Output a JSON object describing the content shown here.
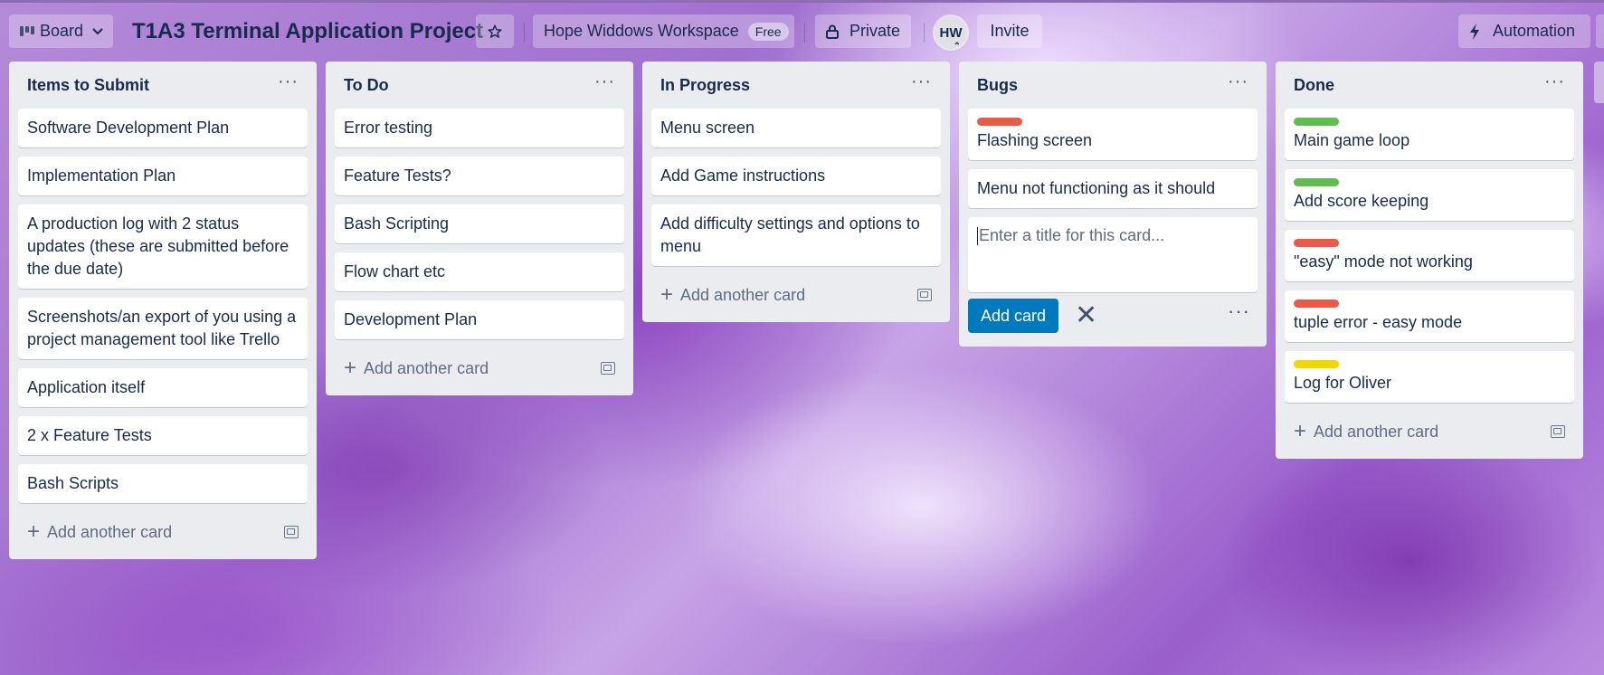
{
  "header": {
    "view_label": "Board",
    "board_title": "T1A3 Terminal Application Project",
    "workspace_name": "Hope Widdows Workspace",
    "workspace_badge": "Free",
    "visibility_label": "Private",
    "avatar_initials": "HW",
    "invite_label": "Invite",
    "automation_label": "Automation"
  },
  "lists": [
    {
      "title": "Items to Submit",
      "cards": [
        {
          "text": "Software Development Plan"
        },
        {
          "text": "Implementation Plan"
        },
        {
          "text": "A production log with 2 status updates (these are submitted before the due date)"
        },
        {
          "text": "Screenshots/an export of you using a project management tool like Trello"
        },
        {
          "text": "Application itself"
        },
        {
          "text": "2 x Feature Tests"
        },
        {
          "text": "Bash Scripts"
        }
      ],
      "add_label": "Add another card"
    },
    {
      "title": "To Do",
      "cards": [
        {
          "text": "Error testing"
        },
        {
          "text": "Feature Tests?"
        },
        {
          "text": "Bash Scripting"
        },
        {
          "text": "Flow chart etc"
        },
        {
          "text": "Development Plan"
        }
      ],
      "add_label": "Add another card"
    },
    {
      "title": "In Progress",
      "cards": [
        {
          "text": "Menu screen"
        },
        {
          "text": "Add Game instructions"
        },
        {
          "text": "Add difficulty settings and options to menu"
        }
      ],
      "add_label": "Add another card"
    },
    {
      "title": "Bugs",
      "cards": [
        {
          "text": "Flashing screen",
          "label_color": "#eb5a46"
        },
        {
          "text": "Menu not functioning as it should"
        }
      ],
      "composer": {
        "placeholder": "Enter a title for this card...",
        "add_button": "Add card"
      }
    },
    {
      "title": "Done",
      "cards": [
        {
          "text": "Main game loop",
          "label_color": "#61bd4f"
        },
        {
          "text": "Add score keeping",
          "label_color": "#61bd4f"
        },
        {
          "text": "\"easy\" mode not working",
          "label_color": "#eb5a46"
        },
        {
          "text": "tuple error - easy mode",
          "label_color": "#eb5a46"
        },
        {
          "text": "Log for Oliver",
          "label_color": "#f2d600"
        }
      ],
      "add_label": "Add another card"
    }
  ],
  "icons": {
    "board_view": "board-view-icon",
    "chevron": "chevron-down-icon",
    "star": "star-icon",
    "lock": "lock-icon",
    "bolt": "lightning-icon",
    "template": "card-template-icon",
    "more": "more-icon",
    "close": "close-icon",
    "plus": "plus-icon"
  }
}
